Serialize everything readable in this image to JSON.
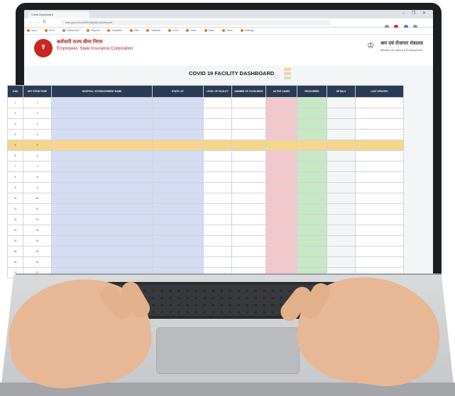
{
  "browser": {
    "tab_title": "Covid Dashboard",
    "window_controls": "– ❐ ✕",
    "url": "esic.gov.in/covid19-facility-dashboard",
    "bookmarks": [
      "Apps",
      "ESIC",
      "Dashboard",
      "Reports",
      "Hospitals",
      "Mail",
      "Calendar",
      "Docs",
      "Drive",
      "Maps",
      "News",
      "Settings"
    ]
  },
  "header": {
    "logo_glyph": "☤",
    "org_name_hindi": "कर्मचारी राज्य बीमा निगम",
    "org_name_english": "Employees' State Insurance Corporation",
    "org_subtitle": "",
    "emblem_glyph": "♔",
    "ministry_hindi": "श्रम एवं रोजगार मंत्रालय",
    "ministry_english": "Ministry of Labour & Employment"
  },
  "dashboard": {
    "title": "COVID 19 FACILITY DASHBOARD",
    "legend": [
      {
        "label": "",
        "color": "#f6d68c"
      },
      {
        "label": "",
        "color": "#f3c8cd"
      },
      {
        "label": "",
        "color": "#c7e8c5"
      }
    ]
  },
  "table": {
    "headers": [
      "S.NO",
      "KEY STRUCTURE",
      "HOSPITAL / ESTABLISHMENT NAME",
      "STATE / UT",
      "LEVEL OF FACILITY",
      "NUMBER OF COVID BEDS",
      "ACTIVE CASES",
      "RECOVERED",
      "DETAILS",
      "LAST UPDATED"
    ],
    "rows": [
      {
        "sno": "1",
        "key": "1",
        "name": "",
        "state": "",
        "level": "",
        "beds": "",
        "active": "",
        "rec": "",
        "details": "",
        "updated": "",
        "highlight": false
      },
      {
        "sno": "2",
        "key": "2",
        "name": "",
        "state": "",
        "level": "",
        "beds": "",
        "active": "",
        "rec": "",
        "details": "",
        "updated": "",
        "highlight": false
      },
      {
        "sno": "3",
        "key": "3",
        "name": "",
        "state": "",
        "level": "",
        "beds": "",
        "active": "",
        "rec": "",
        "details": "",
        "updated": "",
        "highlight": false
      },
      {
        "sno": "4",
        "key": "4",
        "name": "",
        "state": "",
        "level": "",
        "beds": "",
        "active": "",
        "rec": "",
        "details": "",
        "updated": "",
        "highlight": false
      },
      {
        "sno": "5",
        "key": "5",
        "name": "",
        "state": "",
        "level": "",
        "beds": "",
        "active": "",
        "rec": "",
        "details": "",
        "updated": "",
        "highlight": true
      },
      {
        "sno": "6",
        "key": "6",
        "name": "",
        "state": "",
        "level": "",
        "beds": "",
        "active": "",
        "rec": "",
        "details": "",
        "updated": "",
        "highlight": false
      },
      {
        "sno": "7",
        "key": "7",
        "name": "",
        "state": "",
        "level": "",
        "beds": "",
        "active": "",
        "rec": "",
        "details": "",
        "updated": "",
        "highlight": false
      },
      {
        "sno": "8",
        "key": "8",
        "name": "",
        "state": "",
        "level": "",
        "beds": "",
        "active": "",
        "rec": "",
        "details": "",
        "updated": "",
        "highlight": false
      },
      {
        "sno": "9",
        "key": "9",
        "name": "",
        "state": "",
        "level": "",
        "beds": "",
        "active": "",
        "rec": "",
        "details": "",
        "updated": "",
        "highlight": false
      },
      {
        "sno": "10",
        "key": "10",
        "name": "",
        "state": "",
        "level": "",
        "beds": "",
        "active": "",
        "rec": "",
        "details": "",
        "updated": "",
        "highlight": false
      },
      {
        "sno": "11",
        "key": "11",
        "name": "",
        "state": "",
        "level": "",
        "beds": "",
        "active": "",
        "rec": "",
        "details": "",
        "updated": "",
        "highlight": false
      },
      {
        "sno": "12",
        "key": "12",
        "name": "",
        "state": "",
        "level": "",
        "beds": "",
        "active": "",
        "rec": "",
        "details": "",
        "updated": "",
        "highlight": false
      },
      {
        "sno": "13",
        "key": "13",
        "name": "",
        "state": "",
        "level": "",
        "beds": "",
        "active": "",
        "rec": "",
        "details": "",
        "updated": "",
        "highlight": false
      },
      {
        "sno": "14",
        "key": "14",
        "name": "",
        "state": "",
        "level": "",
        "beds": "",
        "active": "",
        "rec": "",
        "details": "",
        "updated": "",
        "highlight": false
      },
      {
        "sno": "15",
        "key": "15",
        "name": "",
        "state": "",
        "level": "",
        "beds": "",
        "active": "",
        "rec": "",
        "details": "",
        "updated": "",
        "highlight": false
      },
      {
        "sno": "16",
        "key": "16",
        "name": "",
        "state": "",
        "level": "",
        "beds": "",
        "active": "",
        "rec": "",
        "details": "",
        "updated": "",
        "highlight": false
      },
      {
        "sno": "17",
        "key": "17",
        "name": "",
        "state": "",
        "level": "",
        "beds": "",
        "active": "",
        "rec": "",
        "details": "",
        "updated": "",
        "highlight": false
      }
    ]
  },
  "colors": {
    "header_bg": "#2b3a55",
    "name_cell": "#d4dcf4",
    "active_cell": "#f3c8cd",
    "recovered_cell": "#c7e8c5",
    "highlight_row": "#f6d68c",
    "brand_red": "#b3261e"
  }
}
